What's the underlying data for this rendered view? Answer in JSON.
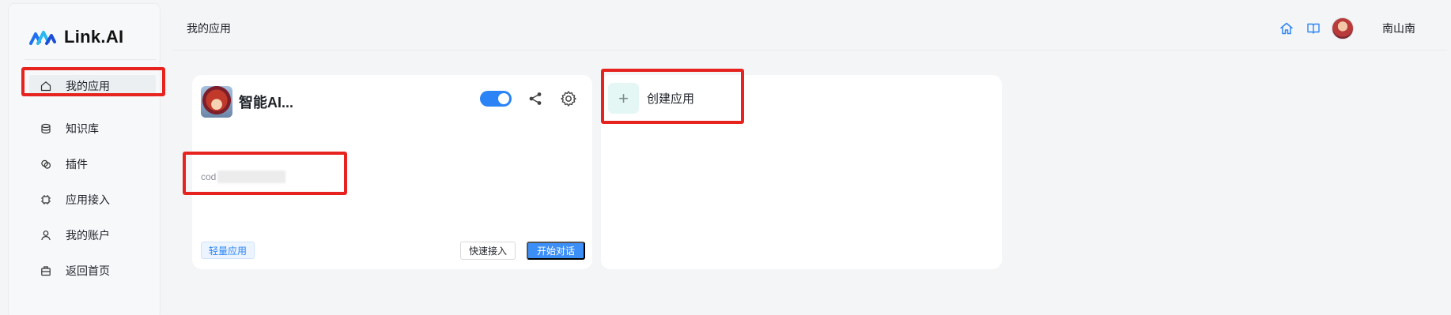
{
  "brand": {
    "name": "Link.AI"
  },
  "sidebar": {
    "items": [
      {
        "label": "我的应用",
        "icon": "home-icon",
        "active": true
      },
      {
        "label": "知识库",
        "icon": "database-icon"
      },
      {
        "label": "插件",
        "icon": "plugin-icon"
      },
      {
        "label": "应用接入",
        "icon": "chip-icon"
      },
      {
        "label": "我的账户",
        "icon": "user-icon"
      },
      {
        "label": "返回首页",
        "icon": "bag-icon"
      }
    ]
  },
  "header": {
    "title": "我的应用",
    "user_name": "南山南",
    "icons": [
      "home-icon",
      "book-icon"
    ]
  },
  "app_card": {
    "name": "智能AI...",
    "description_prefix": "cod",
    "enabled": true,
    "tag": "轻量应用",
    "quick_access_label": "快速接入",
    "start_chat_label": "开始对话"
  },
  "create_card": {
    "label": "创建应用",
    "plus": "+"
  },
  "colors": {
    "accent": "#3d8ff8",
    "annotation": "#e6231e",
    "tag_bg": "#ebf4ff"
  }
}
